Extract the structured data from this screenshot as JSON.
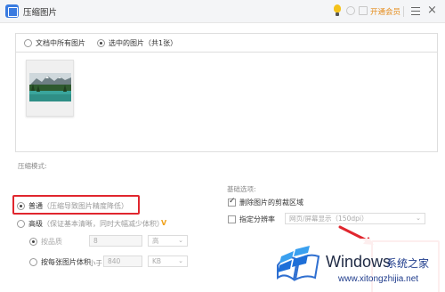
{
  "titlebar": {
    "title": "压缩图片",
    "vip_label": "开通会员",
    "icons": [
      "app-icon",
      "bulb-icon",
      "coin-icon",
      "gift-icon",
      "menu-icon",
      "close-icon"
    ],
    "close_glyph": "×"
  },
  "scope": {
    "options": [
      {
        "label": "文档中所有图片",
        "checked": false
      },
      {
        "label": "选中的图片（共1张）",
        "checked": true
      }
    ]
  },
  "compress_mode": {
    "section_label": "压缩模式:",
    "normal": {
      "label": "普通",
      "hint": "（压缩导致图片精度降低）",
      "checked": true
    },
    "advanced": {
      "label": "高级",
      "hint": "（保证基本清晰，同时大幅减少体积）",
      "checked": false,
      "badge": "V"
    },
    "by_quality": {
      "label": "按品质",
      "value": "8",
      "level": "高",
      "checked": true
    },
    "by_size": {
      "label": "按每张图片体积",
      "prefix": "小于",
      "value": "840",
      "unit": "KB",
      "checked": false
    }
  },
  "basic_options": {
    "section_label": "基础选项:",
    "delete_crop": {
      "label": "删除图片的剪裁区域",
      "checked": true
    },
    "resolution": {
      "label": "指定分辨率",
      "value": "网页/屏幕显示（150dpi）",
      "checked": false
    }
  },
  "watermark": {
    "brand": "Windows",
    "cn": "系统之家",
    "url": "www.xitongzhijia.net"
  },
  "colors": {
    "accent": "#3a7be0",
    "highlight_red": "#e0262e",
    "vip_orange": "#e58d1d"
  }
}
